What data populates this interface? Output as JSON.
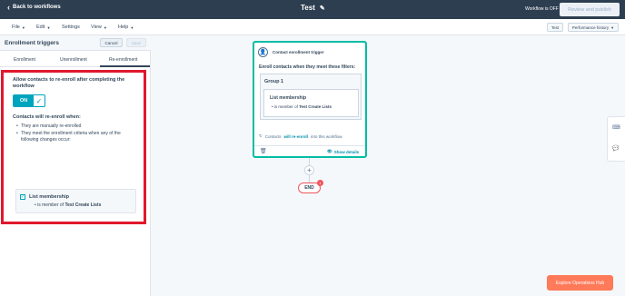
{
  "topbar": {
    "back_label": "Back to workflows",
    "workflow_name": "Test",
    "status": "Workflow is OFF",
    "review_label": "Review and publish"
  },
  "menu": {
    "items": [
      "File",
      "Edit",
      "Settings",
      "View",
      "Help"
    ],
    "test_label": "Test",
    "performance_label": "Performance history"
  },
  "panel": {
    "title": "Enrollment triggers",
    "cancel_label": "Cancel",
    "save_label": "Save",
    "tabs": [
      "Enrollment",
      "Unenrollment",
      "Re-enrollment"
    ],
    "active_tab": "Re-enrollment",
    "allow_text": "Allow contacts to re-enroll after completing the workflow",
    "toggle_label": "ON",
    "reenroll_when": "Contacts will re-enroll when:",
    "bullets": [
      "They are manually re-enrolled",
      "They meet the enrollment criteria when any of the following changes occur:"
    ],
    "criteria": {
      "title": "List membership",
      "prefix": "is member of",
      "value": "Test Create Lists"
    }
  },
  "card": {
    "trigger_label": "Contact enrollment trigger",
    "enroll_line": "Enroll contacts when they meet these filters:",
    "group_title": "Group 1",
    "list_title": "List membership",
    "list_prefix": "is member of",
    "list_value": "Test Create Lists",
    "reenroll_prefix": "Contacts",
    "reenroll_link": "will re-enroll",
    "reenroll_suffix": "into this workflow.",
    "show_details": "Show details"
  },
  "canvas": {
    "end_label": "END",
    "end_badge": "1"
  },
  "explore_label": "Explore Operations Hub",
  "colors": {
    "topbar": "#2d3e50",
    "accent": "#00a4bd",
    "card_border": "#00bda5",
    "highlight": "#e0182d",
    "cta": "#ff7a59"
  }
}
